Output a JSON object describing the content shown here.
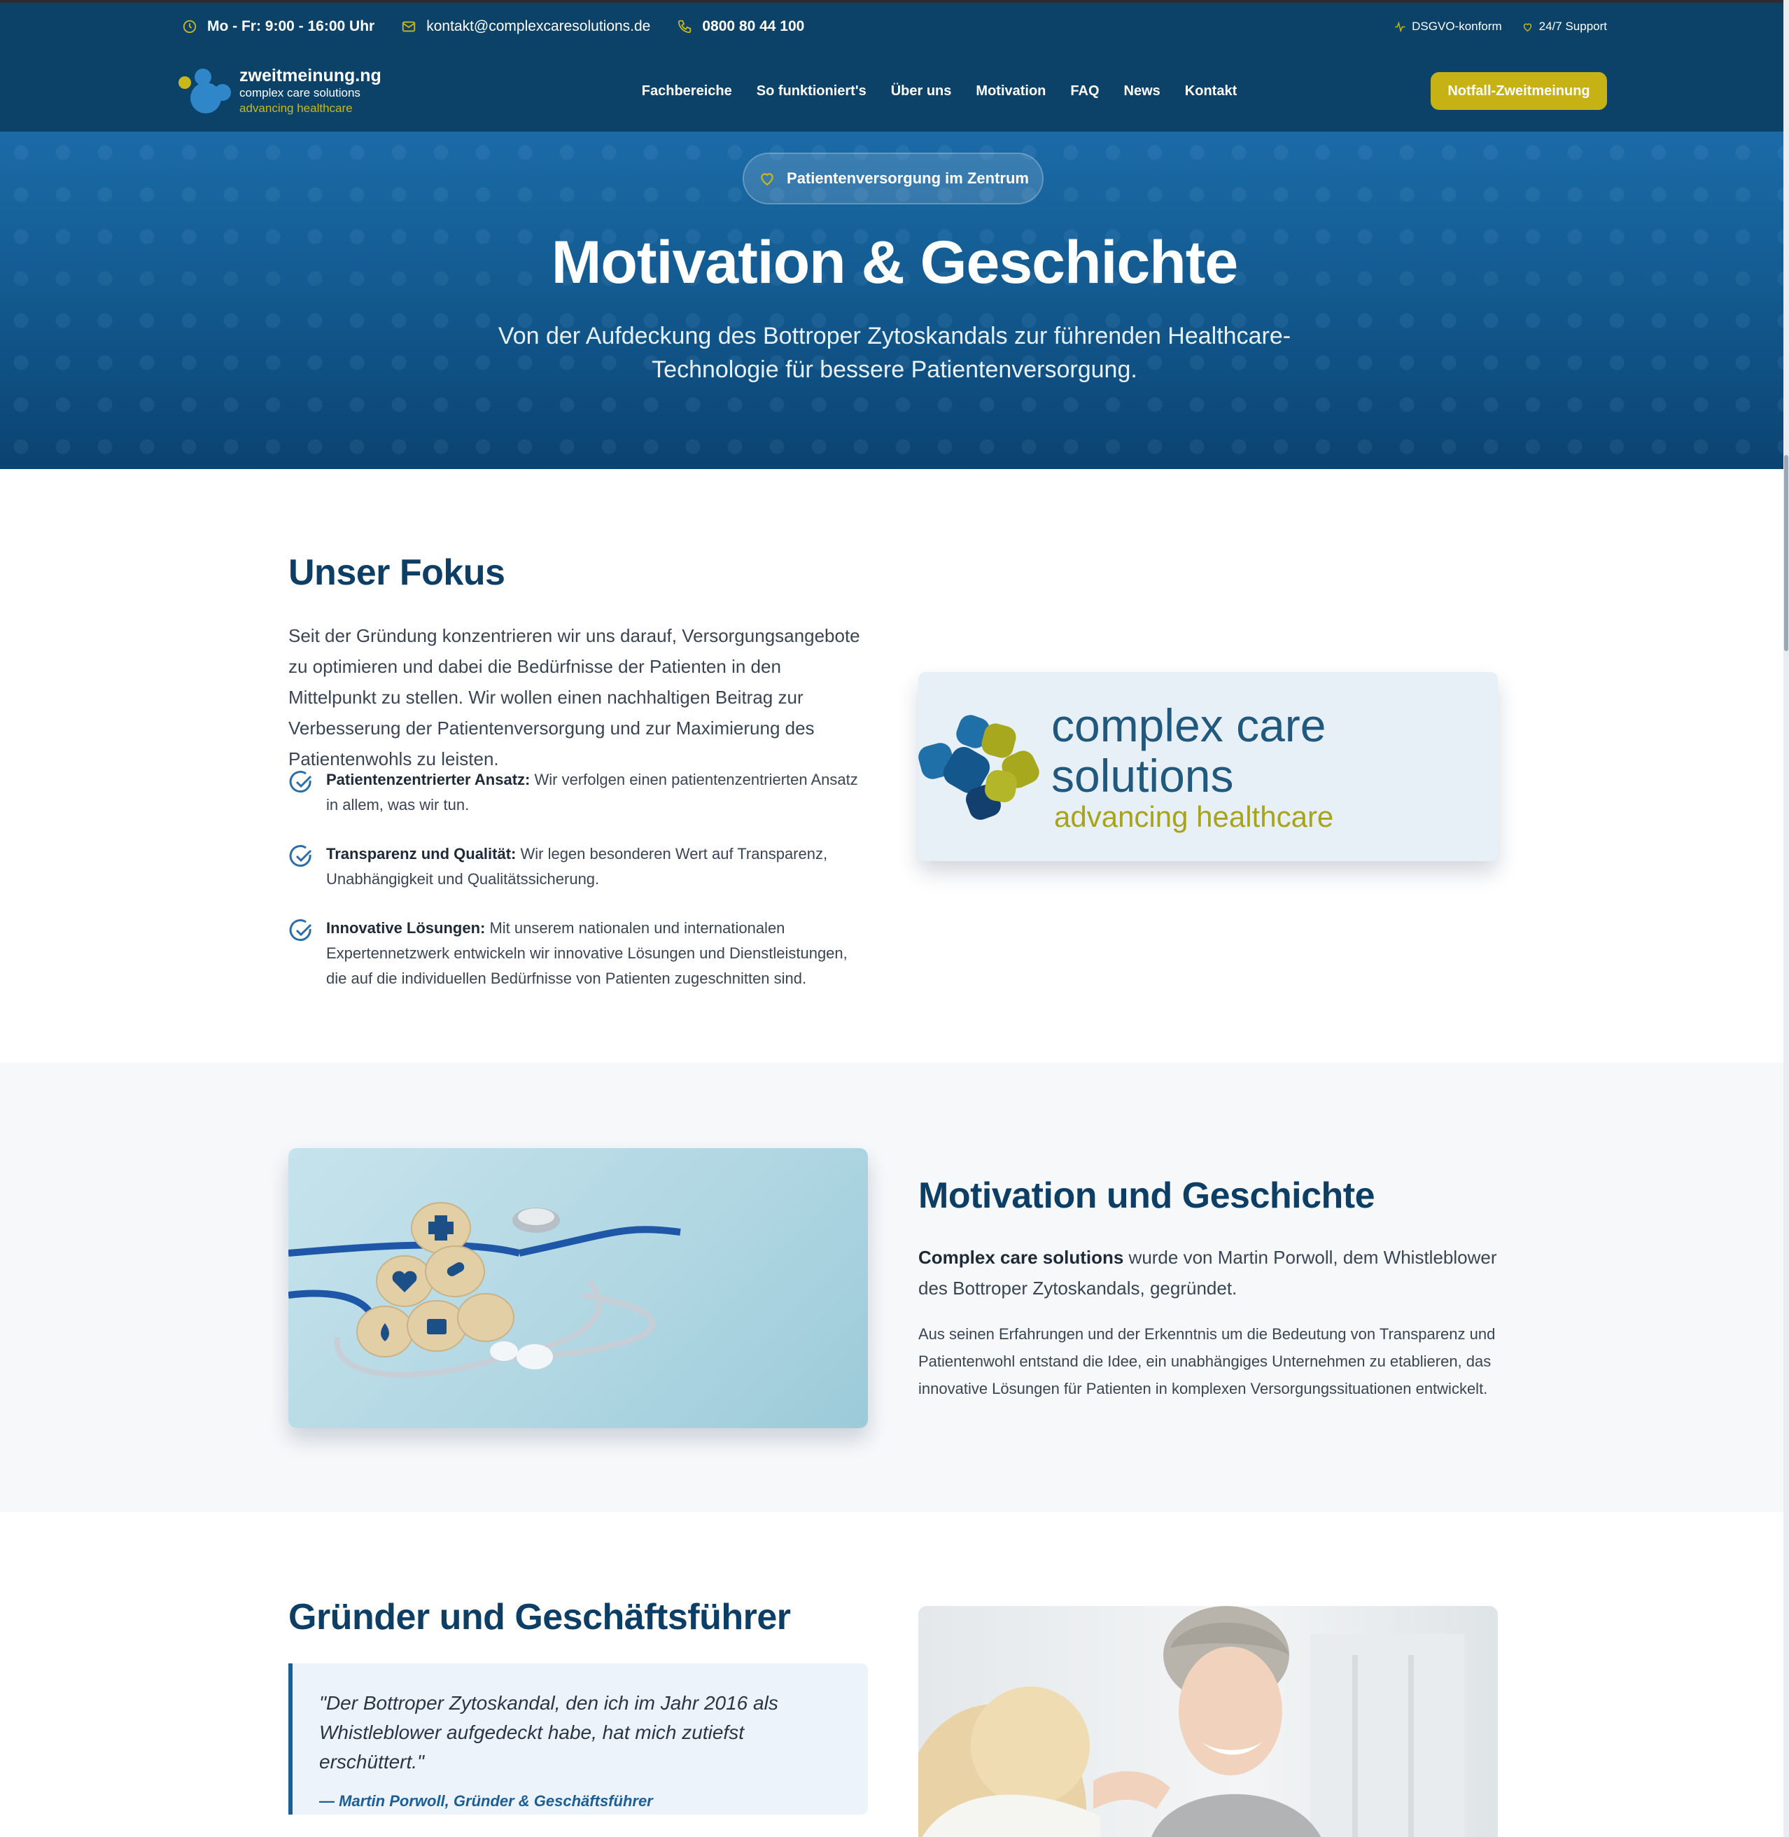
{
  "topbar": {
    "hours": "Mo - Fr: 9:00 - 16:00 Uhr",
    "email": "kontakt@complexcaresolutions.de",
    "phone": "0800 80 44 100",
    "dsgvo": "DSGVO-konform",
    "support": "24/7 Support"
  },
  "logo": {
    "name": "zweitmeinung.ng",
    "line2": "complex care solutions",
    "line3": "advancing healthcare"
  },
  "nav": {
    "items": [
      "Fachbereiche",
      "So funktioniert's",
      "Über uns",
      "Motivation",
      "FAQ",
      "News",
      "Kontakt"
    ],
    "cta": "Notfall-Zweitmeinung"
  },
  "hero": {
    "badge": "Patientenversorgung im Zentrum",
    "title": "Motivation & Geschichte",
    "subtitle": "Von der Aufdeckung des Bottroper Zytoskandals zur führenden Healthcare-Technologie für bessere Patientenversorgung."
  },
  "focus": {
    "title": "Unser Fokus",
    "text": "Seit der Gründung konzentrieren wir uns darauf, Versorgungsangebote zu optimieren und dabei die Bedürfnisse der Patienten in den Mittelpunkt zu stellen. Wir wollen einen nachhaltigen Beitrag zur Verbesserung der Patientenversorgung und zur Maximierung des Patientenwohls zu leisten.",
    "points": [
      {
        "title": "Patientenzentrierter Ansatz:",
        "text": " Wir verfolgen einen patientenzentrierten Ansatz in allem, was wir tun."
      },
      {
        "title": "Transparenz und Qualität:",
        "text": " Wir legen besonderen Wert auf Transparenz, Unabhängigkeit und Qualitätssicherung."
      },
      {
        "title": "Innovative Lösungen:",
        "text": " Mit unserem nationalen und internationalen Expertennetzwerk entwickeln wir innovative Lösungen und Dienstleistungen, die auf die individuellen Bedürfnisse von Patienten zugeschnitten sind."
      }
    ],
    "card_line1": "complex care solutions",
    "card_line2": "advancing healthcare"
  },
  "motivation": {
    "title": "Motivation und Geschichte",
    "lead_bold": "Complex care solutions",
    "lead_rest": " wurde von Martin Porwoll, dem Whistleblower des Bottroper Zytoskandals, gegründet.",
    "body": "Aus seinen Erfahrungen und der Erkenntnis um die Bedeutung von Transparenz und Patientenwohl entstand die Idee, ein unabhängiges Unternehmen zu etablieren, das innovative Lösungen für Patienten in komplexen Versorgungssituationen entwickelt."
  },
  "founder": {
    "title": "Gründer und Geschäftsführer",
    "quote": "\"Der Bottroper Zytoskandal, den ich im Jahr 2016 als Whistleblower aufgedeckt habe, hat mich zutiefst erschüttert.\"",
    "author": "— Martin Porwoll, Gründer & Geschäftsführer"
  },
  "colors": {
    "navy": "#0c4268",
    "accent": "#c6b215",
    "heading": "#0d3f66"
  },
  "icons": [
    "clock-icon",
    "mail-icon",
    "phone-icon",
    "pulse-icon",
    "heart-icon",
    "check-circle-icon"
  ]
}
